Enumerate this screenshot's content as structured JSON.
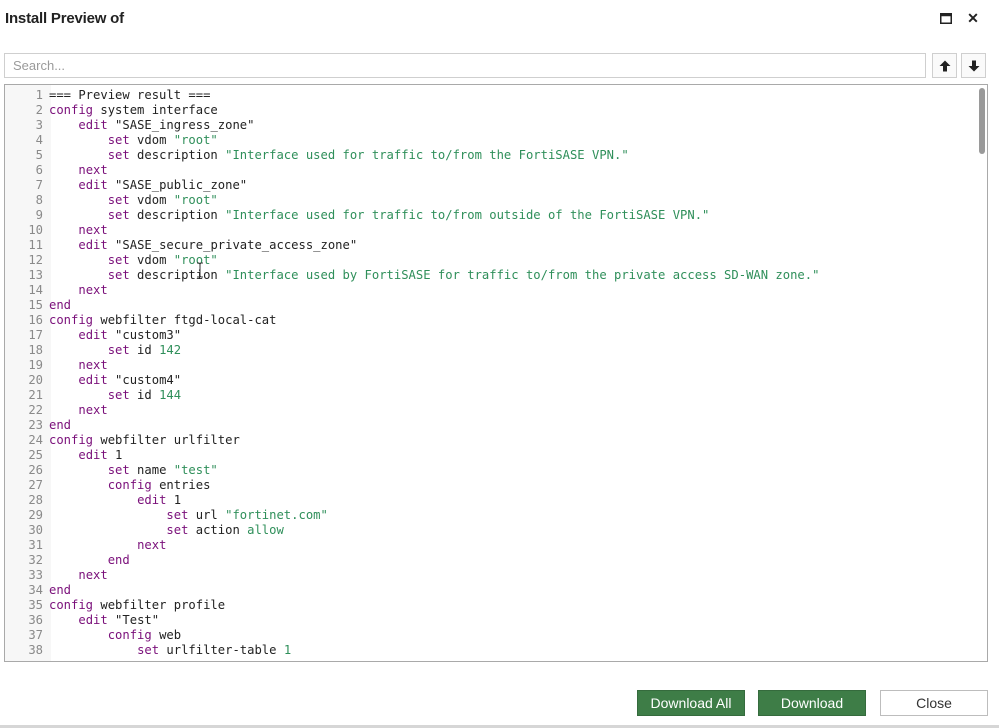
{
  "window": {
    "title": "Install Preview of"
  },
  "search": {
    "placeholder": "Search...",
    "value": ""
  },
  "editor": {
    "lines": [
      {
        "n": "1",
        "seg": [
          {
            "t": "=== Preview result ===",
            "c": "plain"
          }
        ]
      },
      {
        "n": "2",
        "seg": [
          {
            "t": "config",
            "c": "kw"
          },
          {
            "t": " system interface",
            "c": "plain"
          }
        ]
      },
      {
        "n": "3",
        "seg": [
          {
            "t": "    ",
            "c": "plain"
          },
          {
            "t": "edit",
            "c": "kw"
          },
          {
            "t": " \"SASE_ingress_zone\"",
            "c": "plain"
          }
        ]
      },
      {
        "n": "4",
        "seg": [
          {
            "t": "        ",
            "c": "plain"
          },
          {
            "t": "set",
            "c": "kw"
          },
          {
            "t": " vdom ",
            "c": "plain"
          },
          {
            "t": "\"root\"",
            "c": "str"
          }
        ]
      },
      {
        "n": "5",
        "seg": [
          {
            "t": "        ",
            "c": "plain"
          },
          {
            "t": "set",
            "c": "kw"
          },
          {
            "t": " description ",
            "c": "plain"
          },
          {
            "t": "\"Interface used for traffic to/from the FortiSASE VPN.\"",
            "c": "str"
          }
        ]
      },
      {
        "n": "6",
        "seg": [
          {
            "t": "    ",
            "c": "plain"
          },
          {
            "t": "next",
            "c": "kw"
          }
        ]
      },
      {
        "n": "7",
        "seg": [
          {
            "t": "    ",
            "c": "plain"
          },
          {
            "t": "edit",
            "c": "kw"
          },
          {
            "t": " \"SASE_public_zone\"",
            "c": "plain"
          }
        ]
      },
      {
        "n": "8",
        "seg": [
          {
            "t": "        ",
            "c": "plain"
          },
          {
            "t": "set",
            "c": "kw"
          },
          {
            "t": " vdom ",
            "c": "plain"
          },
          {
            "t": "\"root\"",
            "c": "str"
          }
        ]
      },
      {
        "n": "9",
        "seg": [
          {
            "t": "        ",
            "c": "plain"
          },
          {
            "t": "set",
            "c": "kw"
          },
          {
            "t": " description ",
            "c": "plain"
          },
          {
            "t": "\"Interface used for traffic to/from outside of the FortiSASE VPN.\"",
            "c": "str"
          }
        ]
      },
      {
        "n": "10",
        "seg": [
          {
            "t": "    ",
            "c": "plain"
          },
          {
            "t": "next",
            "c": "kw"
          }
        ]
      },
      {
        "n": "11",
        "seg": [
          {
            "t": "    ",
            "c": "plain"
          },
          {
            "t": "edit",
            "c": "kw"
          },
          {
            "t": " \"SASE_secure_private_access_zone\"",
            "c": "plain"
          }
        ]
      },
      {
        "n": "12",
        "seg": [
          {
            "t": "        ",
            "c": "plain"
          },
          {
            "t": "set",
            "c": "kw"
          },
          {
            "t": " vdom ",
            "c": "plain"
          },
          {
            "t": "\"root\"",
            "c": "str"
          }
        ]
      },
      {
        "n": "13",
        "seg": [
          {
            "t": "        ",
            "c": "plain"
          },
          {
            "t": "set",
            "c": "kw"
          },
          {
            "t": " description ",
            "c": "plain"
          },
          {
            "t": "\"Interface used by FortiSASE for traffic to/from the private access SD-WAN zone.\"",
            "c": "str"
          }
        ]
      },
      {
        "n": "14",
        "seg": [
          {
            "t": "    ",
            "c": "plain"
          },
          {
            "t": "next",
            "c": "kw"
          }
        ]
      },
      {
        "n": "15",
        "seg": [
          {
            "t": "end",
            "c": "kw"
          }
        ]
      },
      {
        "n": "16",
        "seg": [
          {
            "t": "config",
            "c": "kw"
          },
          {
            "t": " webfilter ftgd-local-cat",
            "c": "plain"
          }
        ]
      },
      {
        "n": "17",
        "seg": [
          {
            "t": "    ",
            "c": "plain"
          },
          {
            "t": "edit",
            "c": "kw"
          },
          {
            "t": " \"custom3\"",
            "c": "plain"
          }
        ]
      },
      {
        "n": "18",
        "seg": [
          {
            "t": "        ",
            "c": "plain"
          },
          {
            "t": "set",
            "c": "kw"
          },
          {
            "t": " id ",
            "c": "plain"
          },
          {
            "t": "142",
            "c": "str"
          }
        ]
      },
      {
        "n": "19",
        "seg": [
          {
            "t": "    ",
            "c": "plain"
          },
          {
            "t": "next",
            "c": "kw"
          }
        ]
      },
      {
        "n": "20",
        "seg": [
          {
            "t": "    ",
            "c": "plain"
          },
          {
            "t": "edit",
            "c": "kw"
          },
          {
            "t": " \"custom4\"",
            "c": "plain"
          }
        ]
      },
      {
        "n": "21",
        "seg": [
          {
            "t": "        ",
            "c": "plain"
          },
          {
            "t": "set",
            "c": "kw"
          },
          {
            "t": " id ",
            "c": "plain"
          },
          {
            "t": "144",
            "c": "str"
          }
        ]
      },
      {
        "n": "22",
        "seg": [
          {
            "t": "    ",
            "c": "plain"
          },
          {
            "t": "next",
            "c": "kw"
          }
        ]
      },
      {
        "n": "23",
        "seg": [
          {
            "t": "end",
            "c": "kw"
          }
        ]
      },
      {
        "n": "24",
        "seg": [
          {
            "t": "config",
            "c": "kw"
          },
          {
            "t": " webfilter urlfilter",
            "c": "plain"
          }
        ]
      },
      {
        "n": "25",
        "seg": [
          {
            "t": "    ",
            "c": "plain"
          },
          {
            "t": "edit",
            "c": "kw"
          },
          {
            "t": " 1",
            "c": "plain"
          }
        ]
      },
      {
        "n": "26",
        "seg": [
          {
            "t": "        ",
            "c": "plain"
          },
          {
            "t": "set",
            "c": "kw"
          },
          {
            "t": " name ",
            "c": "plain"
          },
          {
            "t": "\"test\"",
            "c": "str"
          }
        ]
      },
      {
        "n": "27",
        "seg": [
          {
            "t": "        ",
            "c": "plain"
          },
          {
            "t": "config",
            "c": "kw"
          },
          {
            "t": " entries",
            "c": "plain"
          }
        ]
      },
      {
        "n": "28",
        "seg": [
          {
            "t": "            ",
            "c": "plain"
          },
          {
            "t": "edit",
            "c": "kw"
          },
          {
            "t": " 1",
            "c": "plain"
          }
        ]
      },
      {
        "n": "29",
        "seg": [
          {
            "t": "                ",
            "c": "plain"
          },
          {
            "t": "set",
            "c": "kw"
          },
          {
            "t": " url ",
            "c": "plain"
          },
          {
            "t": "\"fortinet.com\"",
            "c": "str"
          }
        ]
      },
      {
        "n": "30",
        "seg": [
          {
            "t": "                ",
            "c": "plain"
          },
          {
            "t": "set",
            "c": "kw"
          },
          {
            "t": " action ",
            "c": "plain"
          },
          {
            "t": "allow",
            "c": "str"
          }
        ]
      },
      {
        "n": "31",
        "seg": [
          {
            "t": "            ",
            "c": "plain"
          },
          {
            "t": "next",
            "c": "kw"
          }
        ]
      },
      {
        "n": "32",
        "seg": [
          {
            "t": "        ",
            "c": "plain"
          },
          {
            "t": "end",
            "c": "kw"
          }
        ]
      },
      {
        "n": "33",
        "seg": [
          {
            "t": "    ",
            "c": "plain"
          },
          {
            "t": "next",
            "c": "kw"
          }
        ]
      },
      {
        "n": "34",
        "seg": [
          {
            "t": "end",
            "c": "kw"
          }
        ]
      },
      {
        "n": "35",
        "seg": [
          {
            "t": "config",
            "c": "kw"
          },
          {
            "t": " webfilter profile",
            "c": "plain"
          }
        ]
      },
      {
        "n": "36",
        "seg": [
          {
            "t": "    ",
            "c": "plain"
          },
          {
            "t": "edit",
            "c": "kw"
          },
          {
            "t": " \"Test\"",
            "c": "plain"
          }
        ]
      },
      {
        "n": "37",
        "seg": [
          {
            "t": "        ",
            "c": "plain"
          },
          {
            "t": "config",
            "c": "kw"
          },
          {
            "t": " web",
            "c": "plain"
          }
        ]
      },
      {
        "n": "38",
        "seg": [
          {
            "t": "            ",
            "c": "plain"
          },
          {
            "t": "set",
            "c": "kw"
          },
          {
            "t": " urlfilter-table ",
            "c": "plain"
          },
          {
            "t": "1",
            "c": "str"
          }
        ]
      }
    ]
  },
  "footer": {
    "download_all_label": "Download All",
    "download_label": "Download",
    "close_label": "Close"
  },
  "colors": {
    "keyword": "#7a0f7a",
    "string": "#2f8f5a",
    "button_green": "#3e7d47"
  }
}
